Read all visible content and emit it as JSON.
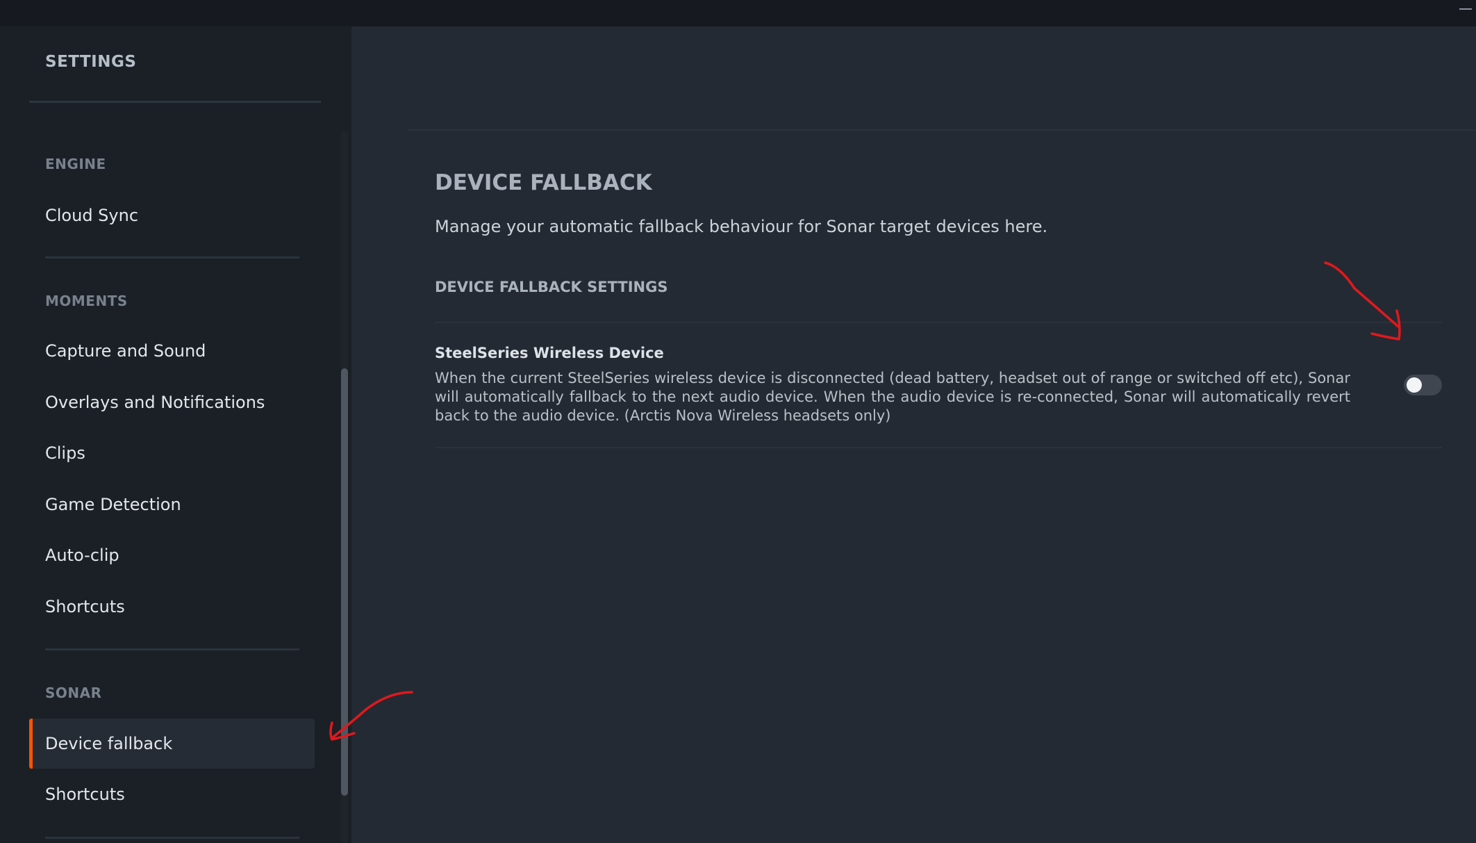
{
  "sidebar": {
    "title": "SETTINGS",
    "sections": [
      {
        "header": "ENGINE",
        "items": [
          "Cloud Sync"
        ]
      },
      {
        "header": "MOMENTS",
        "items": [
          "Capture and Sound",
          "Overlays and Notifications",
          "Clips",
          "Game Detection",
          "Auto-clip",
          "Shortcuts"
        ]
      },
      {
        "header": "SONAR",
        "items": [
          "Device fallback",
          "Shortcuts"
        ]
      }
    ],
    "active_item": "Device fallback"
  },
  "main": {
    "heading": "DEVICE FALLBACK",
    "description": "Manage your automatic fallback behaviour for Sonar target devices here.",
    "settings_header": "DEVICE FALLBACK SETTINGS",
    "option": {
      "title": "SteelSeries Wireless Device",
      "description": "When the current SteelSeries wireless device is disconnected (dead battery, headset out of range or switched off etc), Sonar will automatically fallback to the next audio device. When the audio device is re-connected, Sonar will automatically revert back to the audio device. (Arctis Nova Wireless headsets only)",
      "enabled": false
    }
  },
  "colors": {
    "accent": "#ff5200",
    "annotation": "#e0191d"
  }
}
